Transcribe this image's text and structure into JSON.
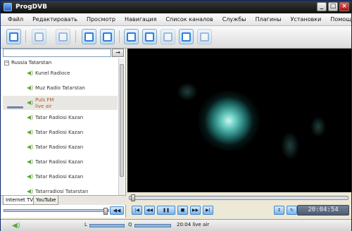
{
  "window": {
    "title": "ProgDVB"
  },
  "menu": [
    "Файл",
    "Редактировать",
    "Просмотр",
    "Навигация",
    "Список каналов",
    "Службы",
    "Плагины",
    "Установки",
    "Помощь"
  ],
  "search": {
    "value": "",
    "go_label": "→"
  },
  "tree": {
    "group": "Russia Tatarstan",
    "channels": [
      {
        "name": "Kunel Radioce",
        "sub": ""
      },
      {
        "name": "Muz Radio Tatarstan",
        "sub": ""
      },
      {
        "name": "Puls FM",
        "sub": "live air",
        "active": true
      },
      {
        "name": "Tatar Radiosi Kazan",
        "sub": ""
      },
      {
        "name": "Tatar Radiosi Kazan",
        "sub": ""
      },
      {
        "name": "Tatar Radiosi Kazan",
        "sub": ""
      },
      {
        "name": "Tatar Radiosi Kazan",
        "sub": ""
      },
      {
        "name": "Tatar Radiosi Kazan",
        "sub": ""
      },
      {
        "name": "Tatarradiosi Tatarstan",
        "sub": ""
      }
    ]
  },
  "tabs": [
    "Internet TV",
    "YouTube"
  ],
  "volume": {
    "level": 0.94,
    "button_label": "◀◀"
  },
  "playback": {
    "progress": 0.0
  },
  "time": "20:04:54",
  "status": {
    "left_label": "L",
    "right_label": "Q",
    "text": "20:04 live air"
  },
  "colors": {
    "accent": "#2f7fd6",
    "active_channel": "#b15a1b",
    "speaker": "#5ca83c"
  }
}
